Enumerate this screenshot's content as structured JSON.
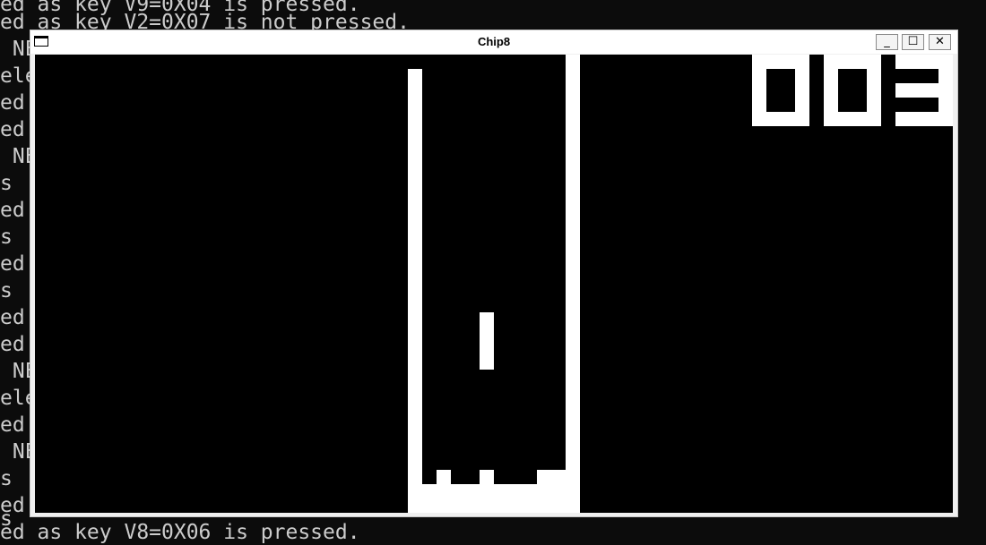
{
  "terminal": {
    "lines": [
      "ed as key V9=0X04 is pressed.",
      "ed as key V2=0X07 is not pressed.",
      " NEW",
      "eleased",
      "ed",
      "ed",
      " NEW",
      "s",
      "ed",
      "s",
      "ed",
      "s",
      "ed",
      "ed",
      " NEW",
      "eleased",
      "ed",
      " NEW",
      "s",
      "ed",
      "s",
      "ed as key V8=0X06 is pressed."
    ],
    "text_color": "#cccccc",
    "background": "#0c0c0c"
  },
  "window": {
    "title": "Chip8",
    "minimize_glyph": "_",
    "maximize_glyph": "☐",
    "close_glyph": "✕"
  },
  "game": {
    "score": "003",
    "pixel_on_color": "#ffffff",
    "pixel_off_color": "#000000"
  }
}
